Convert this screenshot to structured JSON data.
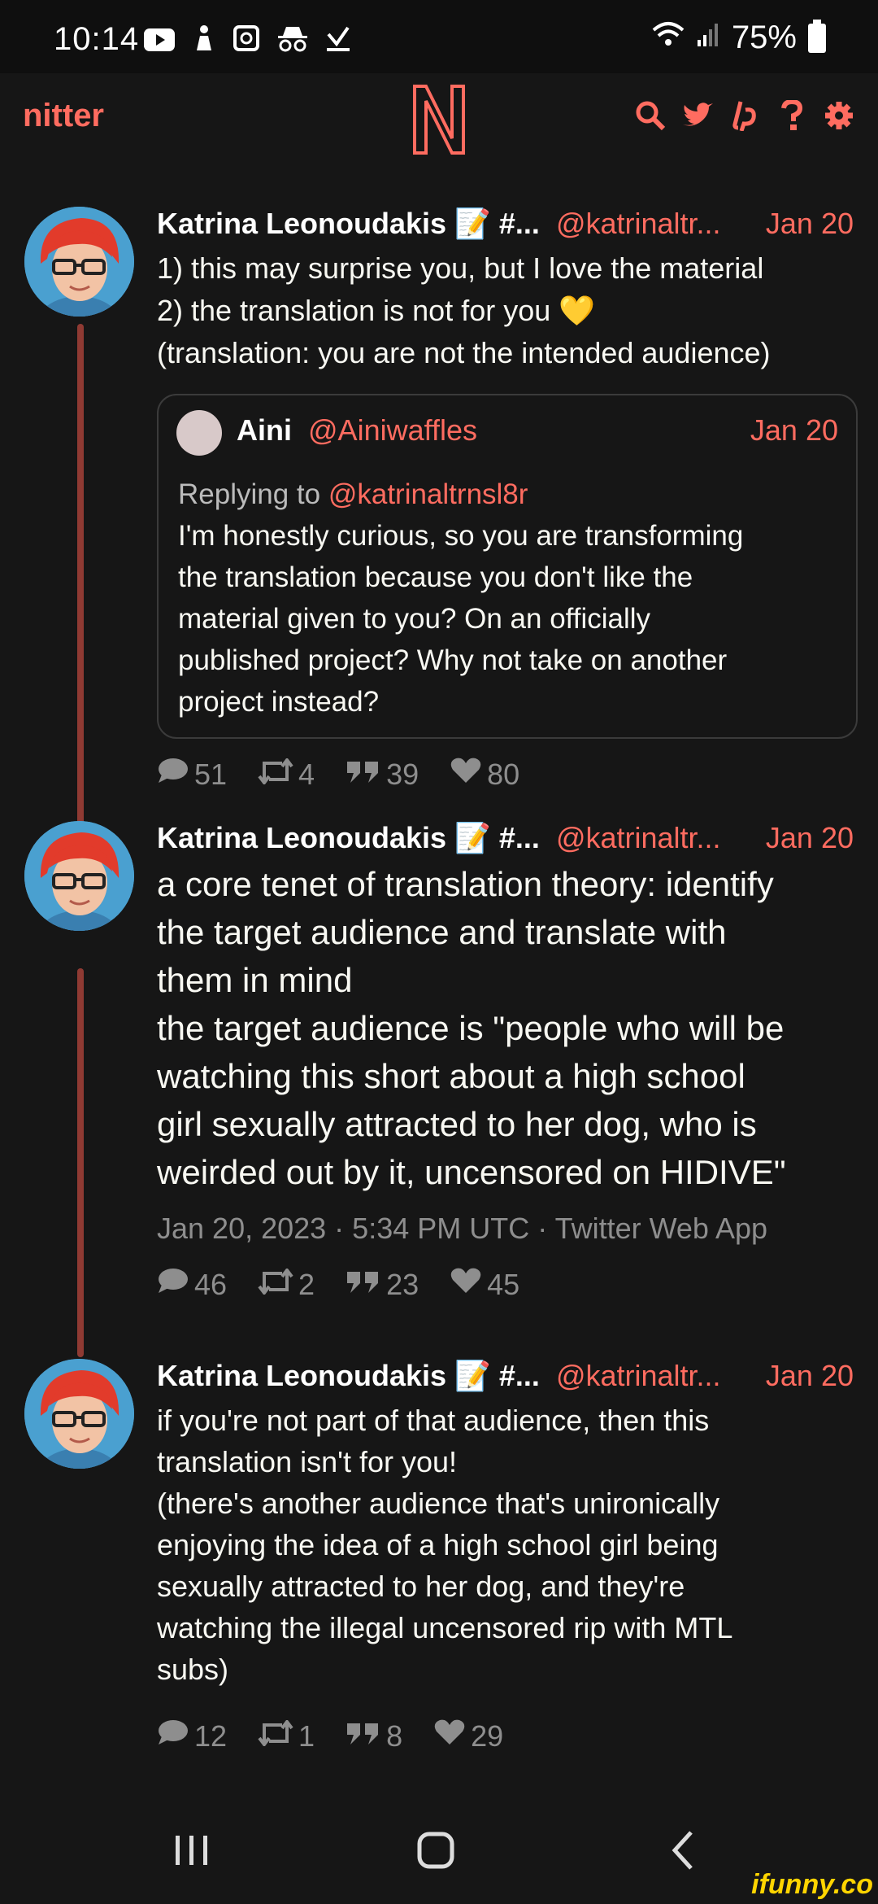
{
  "status": {
    "time": "10:14",
    "battery": "75%",
    "icons_left": [
      "youtube-icon",
      "gesture-icon",
      "alarm-icon",
      "incognito-icon",
      "download-icon"
    ]
  },
  "header": {
    "brand": "nitter",
    "logo_letter": "N"
  },
  "tweets": [
    {
      "name": "Katrina Leonoudakis",
      "name_suffix": "📝 #...",
      "handle": "@katrinaltr...",
      "date": "Jan 20",
      "text": "1) this may surprise you, but I love the material\n2) the translation is not for you 💛\n(translation: you are not the intended audience)",
      "quote": {
        "name": "Aini",
        "handle": "@Ainiwaffles",
        "date": "Jan 20",
        "replying_prefix": "Replying to ",
        "replying_handle": "@katrinaltrnsl8r",
        "text": "I'm honestly curious, so you are transforming\nthe translation because you don't like the\nmaterial given to you? On an officially\npublished project? Why not take on another\nproject instead?"
      },
      "stats": {
        "replies": "51",
        "retweets": "4",
        "quotes": "39",
        "likes": "80"
      }
    },
    {
      "name": "Katrina Leonoudakis",
      "name_suffix": "📝 #...",
      "handle": "@katrinaltr...",
      "date": "Jan 20",
      "text": "a core tenet of translation theory: identify\nthe target audience and translate with\nthem in mind\nthe target audience is \"people who will be\nwatching this short about a high school\ngirl sexually attracted to her dog, who is\nweirded out by it, uncensored on HIDIVE\"",
      "meta": "Jan 20, 2023 · 5:34 PM UTC · Twitter Web App",
      "stats": {
        "replies": "46",
        "retweets": "2",
        "quotes": "23",
        "likes": "45"
      }
    },
    {
      "name": "Katrina Leonoudakis",
      "name_suffix": "📝 #...",
      "handle": "@katrinaltr...",
      "date": "Jan 20",
      "text": "if you're not part of that audience, then this\ntranslation isn't for you!\n(there's another audience that's unironically\nenjoying the idea of a high school girl being\nsexually attracted to her dog, and they're\nwatching the illegal uncensored rip with MTL\nsubs)",
      "stats": {
        "replies": "12",
        "retweets": "1",
        "quotes": "8",
        "likes": "29"
      }
    }
  ],
  "watermark": "ifunny.co",
  "colors": {
    "accent": "#ff6c60",
    "bg": "#161616",
    "muted": "#8e8e8e",
    "thread": "#8f3a33"
  }
}
